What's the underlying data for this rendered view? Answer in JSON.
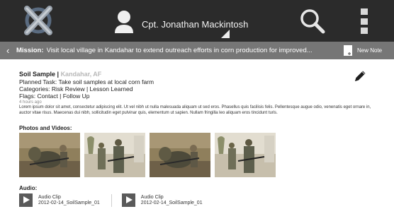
{
  "header": {
    "user_name": "Cpt. Jonathan Mackintosh",
    "bg_color": "#2b2b2b"
  },
  "mission": {
    "label": "Mission:",
    "text": "Visit local village in Kandahar to extend outreach efforts in corn production for improved...",
    "new_note_label": "New Note",
    "bg_color": "#767676"
  },
  "note": {
    "title": "Soil Sample",
    "separator": " | ",
    "location": "Kandahar, AF",
    "planned_task": "Planned Task: Take soil samples at local corn farm",
    "categories": "Categories: Risk Review | Lesson Learned",
    "flags": "Flags: Contact | Follow Up",
    "time_ago": "4 hours ago",
    "description": "Lorem ipsum dolor sit amet, consectetur adipiscing elit. Ut vel nibh ut nulla malesuada aliquam ut sed eros. Phasellus quis facilisis felis. Pellentesque augue odio, venenatis eget ornare in, auctor vitae risus. Maecenas dui nibh, sollicitudin eget pulvinar quis, elementum ut sapien. Nullam fringilla leo aliquam eros tincidunt turis."
  },
  "photos": {
    "section_title": "Photos and Videos:",
    "items": [
      "photo-thumbnail-1",
      "photo-thumbnail-2",
      "photo-thumbnail-3",
      "photo-thumbnail-4"
    ]
  },
  "audio": {
    "section_title": "Audio:",
    "clips": [
      {
        "title": "Audio Clip",
        "filename": "2012-02-14_SoilSample_01"
      },
      {
        "title": "Audio Clip",
        "filename": "2012-02-14_SoilSample_01"
      }
    ]
  }
}
